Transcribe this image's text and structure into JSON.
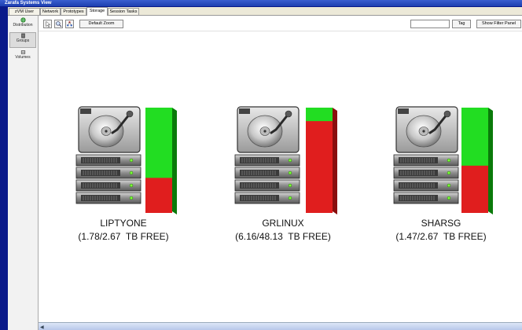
{
  "window": {
    "title": "Zarafa Systems View"
  },
  "tabs": [
    {
      "label": "zVM User Groups"
    },
    {
      "label": "Network"
    },
    {
      "label": "Prototypes"
    },
    {
      "label": "Storage",
      "active": true
    },
    {
      "label": "Session Tasks"
    }
  ],
  "sidebar": {
    "items": [
      {
        "label": "Distribution",
        "icon": "globe-icon"
      },
      {
        "label": "Groups",
        "icon": "server-icon",
        "selected": true
      },
      {
        "label": "Volumes",
        "icon": "disk-icon"
      }
    ]
  },
  "toolbar": {
    "default_zoom_label": "Default Zoom",
    "tag_input_value": "",
    "tag_button_label": "Tag",
    "filter_button_label": "Show Filter Panel"
  },
  "volumes": [
    {
      "name": "LIPTYONE",
      "free_label": "(1.78/2.67  TB FREE)",
      "used_fraction": 0.333
    },
    {
      "name": "GRLINUX",
      "free_label": "(6.16/48.13  TB FREE)",
      "used_fraction": 0.872
    },
    {
      "name": "SHARSG",
      "free_label": "(1.47/2.67  TB FREE)",
      "used_fraction": 0.449
    }
  ],
  "colors": {
    "free": "#22dd22",
    "used": "#e01e1e",
    "window_frame": "#0a1a8a",
    "title_gradient": "#1d3fb0"
  }
}
